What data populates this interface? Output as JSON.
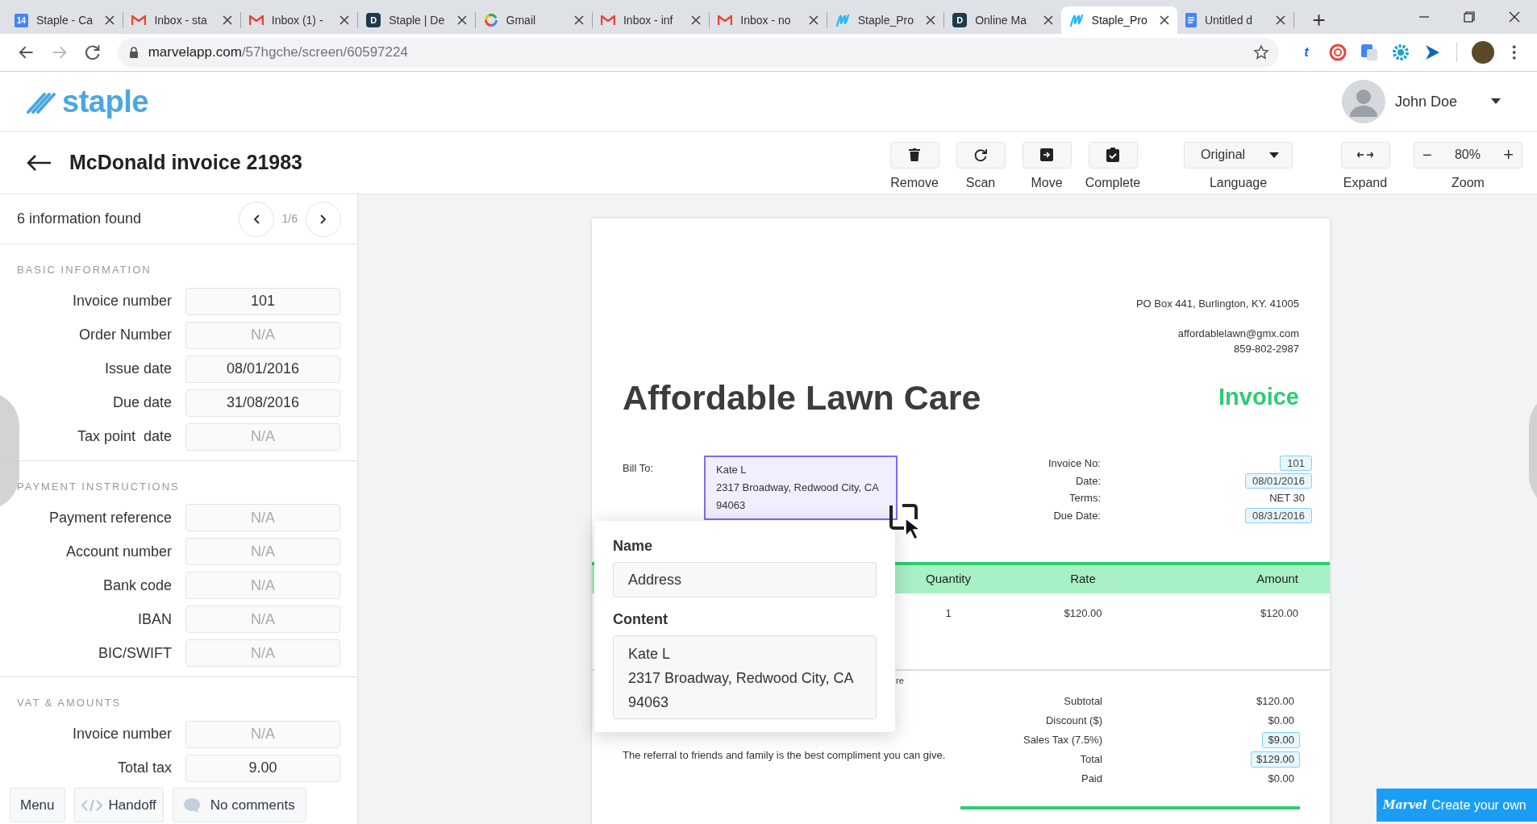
{
  "browser": {
    "tabs": [
      {
        "kind": "calendar",
        "icon_text": "14",
        "title": "Staple - Ca",
        "selected": false
      },
      {
        "kind": "mail",
        "title": "Inbox - sta",
        "selected": false
      },
      {
        "kind": "mail",
        "title": "Inbox (1) -",
        "selected": false
      },
      {
        "kind": "letter",
        "icon_text": "D",
        "title": "Staple | De",
        "selected": false
      },
      {
        "kind": "search",
        "title": "Gmail",
        "selected": false
      },
      {
        "kind": "mail",
        "title": "Inbox - inf",
        "selected": false
      },
      {
        "kind": "mail",
        "title": "Inbox - no",
        "selected": false
      },
      {
        "kind": "wave",
        "title": "Staple_Pro",
        "selected": false
      },
      {
        "kind": "letter",
        "icon_text": "D",
        "title": "Online Ma",
        "selected": false
      },
      {
        "kind": "wave",
        "title": "Staple_Pro",
        "selected": true
      },
      {
        "kind": "document",
        "title": "Untitled d",
        "selected": false
      }
    ],
    "url": {
      "host": "marvelapp.com",
      "path": "/57hgche/screen/60597224"
    },
    "extensions": [
      {
        "kind": "letter",
        "label": "t"
      },
      {
        "kind": "ring"
      },
      {
        "kind": "translate"
      },
      {
        "kind": "gear"
      },
      {
        "kind": "play"
      }
    ]
  },
  "app": {
    "logo": "staple",
    "user": {
      "name": "John Doe"
    },
    "title": "McDonald invoice 21983",
    "toolbar": [
      {
        "kind": "trash",
        "label": "Remove"
      },
      {
        "kind": "rotate",
        "label": "Scan"
      },
      {
        "kind": "move",
        "label": "Move"
      },
      {
        "kind": "check",
        "label": "Complete"
      }
    ],
    "language": {
      "value": "Original",
      "label": "Language"
    },
    "expand": {
      "label": "Expand"
    },
    "zoom": {
      "minus": "−",
      "value": "80%",
      "plus": "+",
      "label": "Zoom"
    }
  },
  "sidebar": {
    "found": "6 information found",
    "pager": "1/6",
    "sections": [
      {
        "title": "BASIC INFORMATION",
        "fields": [
          {
            "label": "Invoice number",
            "value": "101"
          },
          {
            "label": "Order Number",
            "placeholder": "N/A"
          },
          {
            "label": "Issue date",
            "value": "08/01/2016"
          },
          {
            "label": "Due date",
            "value": "31/08/2016"
          },
          {
            "label": "Tax point  date",
            "placeholder": "N/A"
          }
        ]
      },
      {
        "title": "PAYMENT INSTRUCTIONS",
        "fields": [
          {
            "label": "Payment reference",
            "placeholder": "N/A"
          },
          {
            "label": "Account number",
            "placeholder": "N/A"
          },
          {
            "label": "Bank code",
            "placeholder": "N/A"
          },
          {
            "label": "IBAN",
            "placeholder": "N/A"
          },
          {
            "label": "BIC/SWIFT",
            "placeholder": "N/A"
          }
        ]
      },
      {
        "title": "VAT & AMOUNTS",
        "fields": [
          {
            "label": "Invoice number",
            "placeholder": "N/A"
          },
          {
            "label": "Total tax",
            "value": "9.00"
          }
        ]
      }
    ]
  },
  "invoice": {
    "address": [
      "PO Box 441, Burlington, KY. 41005"
    ],
    "contact": [
      "affordablelawn@gmx.com",
      "859-802-2987"
    ],
    "company": "Affordable Lawn Care",
    "doc_title": "Invoice",
    "bill_to": {
      "label": "Bill To:",
      "lines": [
        "Kate L",
        "2317 Broadway, Redwood City, CA",
        "94063"
      ],
      "highlighted": true
    },
    "meta": [
      {
        "label": "Invoice No:",
        "value": "101",
        "highlighted": true
      },
      {
        "label": "Date:",
        "value": "08/01/2016",
        "highlighted": true
      },
      {
        "label": "Terms:",
        "value": "NET 30",
        "highlighted": false
      },
      {
        "label": "Due Date:",
        "value": "08/31/2016",
        "highlighted": true
      }
    ],
    "columns": [
      "Quantity",
      "Rate",
      "Amount"
    ],
    "rows": [
      [
        "1",
        "$120.00",
        "$120.00"
      ]
    ],
    "fragment": "re",
    "note": "The referral to friends and family is the best compliment you can give.",
    "totals": [
      {
        "label": "Subtotal",
        "value": "$120.00",
        "highlighted": false
      },
      {
        "label": "Discount ($)",
        "value": "$0.00",
        "highlighted": false
      },
      {
        "label": "Sales Tax (7.5%)",
        "value": "$9.00",
        "highlighted": true
      },
      {
        "label": "Total",
        "value": "$129.00",
        "highlighted": true
      },
      {
        "label": "Paid",
        "value": "$0.00",
        "highlighted": false
      }
    ]
  },
  "popup": {
    "name_label": "Name",
    "name_value": "Address",
    "content_label": "Content",
    "content_lines": [
      "Kate L",
      "2317 Broadway, Redwood City, CA",
      "94063"
    ]
  },
  "footer": {
    "menu": "Menu",
    "handoff": "Handoff",
    "comments": "No comments",
    "brand": "Marvel",
    "cta": "Create your own"
  }
}
